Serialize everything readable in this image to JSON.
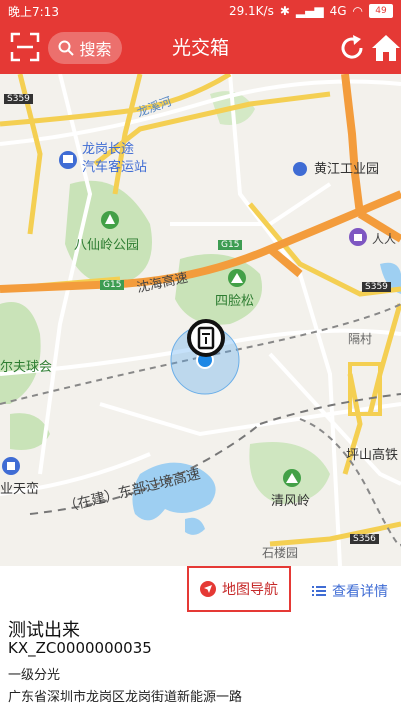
{
  "status_bar": {
    "time": "晚上7:13",
    "network_speed": "29.1K/s",
    "network_type": "4G",
    "battery": "49"
  },
  "app_bar": {
    "title": "光交箱",
    "search_label": "搜索",
    "accent_color": "#e53935"
  },
  "map": {
    "labels": {
      "longgang_river": "龙溪河",
      "bus_station_line1": "龙岗长途",
      "bus_station_line2": "汽车客运站",
      "huangjiang": "黄江工业园",
      "renren": "人人",
      "baxianling": "八仙岭公园",
      "g15_a": "G15",
      "g15_b": "G15",
      "shenhai": "沈海高速",
      "silian_song": "四脸松",
      "s359_a": "S359",
      "s359_b": "S359",
      "gecun": "隔村",
      "golf": "尔夫球会",
      "pingshan": "坪山高铁",
      "east_highway": "（在建）东部过境高速",
      "qingfengling": "清风岭",
      "yetiandai": "业天峦",
      "shilouyuan": "石楼园",
      "s356": "S356"
    }
  },
  "actions": {
    "navigate_label": "地图导航",
    "details_label": "查看详情"
  },
  "info": {
    "name": "测试出来",
    "code": "KX_ZC0000000035",
    "level": "一级分光",
    "address": "广东省深圳市龙岗区龙岗街道新能源一路"
  }
}
